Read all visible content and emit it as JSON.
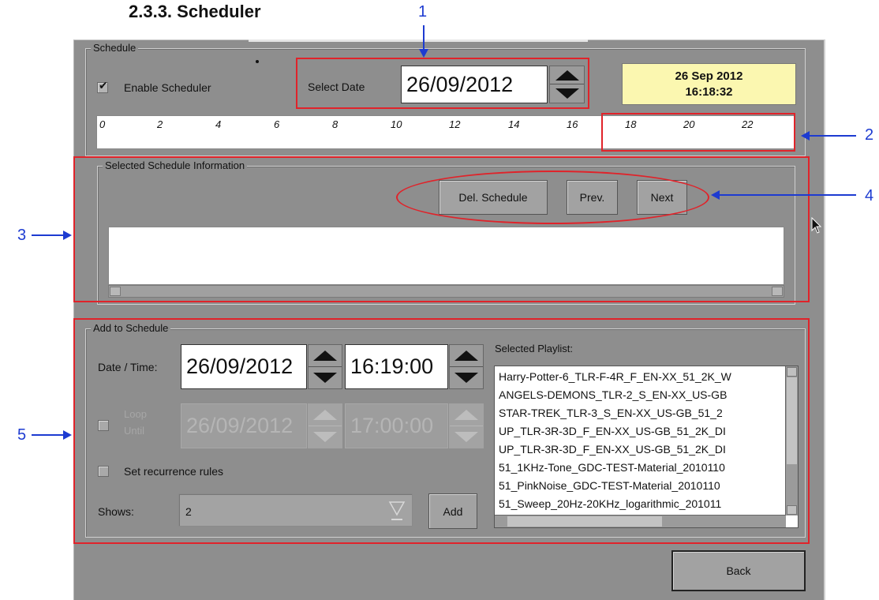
{
  "doc_heading": "2.3.3. Scheduler",
  "schedule_group": {
    "legend": "Schedule",
    "enable_scheduler": {
      "label": "Enable Scheduler",
      "checked": true
    },
    "select_date_label": "Select Date",
    "select_date_value": "26/09/2012",
    "clock_date": "26 Sep 2012",
    "clock_time": "16:18:32",
    "timeline_ticks": [
      "0",
      "2",
      "4",
      "6",
      "8",
      "10",
      "12",
      "14",
      "16",
      "18",
      "20",
      "22"
    ]
  },
  "selected_info": {
    "legend": "Selected Schedule Information",
    "del_schedule": "Del. Schedule",
    "prev": "Prev.",
    "next": "Next"
  },
  "add_to_schedule": {
    "legend": "Add to Schedule",
    "date_time_label": "Date / Time:",
    "date_value": "26/09/2012",
    "time_value": "16:19:00",
    "loop_until_label_1": "Loop",
    "loop_until_label_2": "Until",
    "loop_until_checked": false,
    "loop_date_value": "26/09/2012",
    "loop_time_value": "17:00:00",
    "recurrence_label": "Set recurrence rules",
    "recurrence_checked": false,
    "shows_label": "Shows:",
    "shows_value": "2",
    "add_button": "Add",
    "selected_playlist_label": "Selected Playlist:",
    "playlist_items": [
      "Harry-Potter-6_TLR-F-4R_F_EN-XX_51_2K_W",
      "ANGELS-DEMONS_TLR-2_S_EN-XX_US-GB",
      "STAR-TREK_TLR-3_S_EN-XX_US-GB_51_2",
      "UP_TLR-3R-3D_F_EN-XX_US-GB_51_2K_DI",
      "UP_TLR-3R-3D_F_EN-XX_US-GB_51_2K_DI",
      "51_1KHz-Tone_GDC-TEST-Material_2010110",
      "51_PinkNoise_GDC-TEST-Material_2010110",
      "51_Sweep_20Hz-20KHz_logarithmic_201011"
    ]
  },
  "back_button": "Back",
  "callouts": [
    "1",
    "2",
    "3",
    "4",
    "5"
  ],
  "colors": {
    "annotation_red": "#e0232a",
    "callout_blue": "#1d3bd1",
    "clock_bg": "#fbf7b0",
    "panel_gray": "#8e8e8e"
  }
}
